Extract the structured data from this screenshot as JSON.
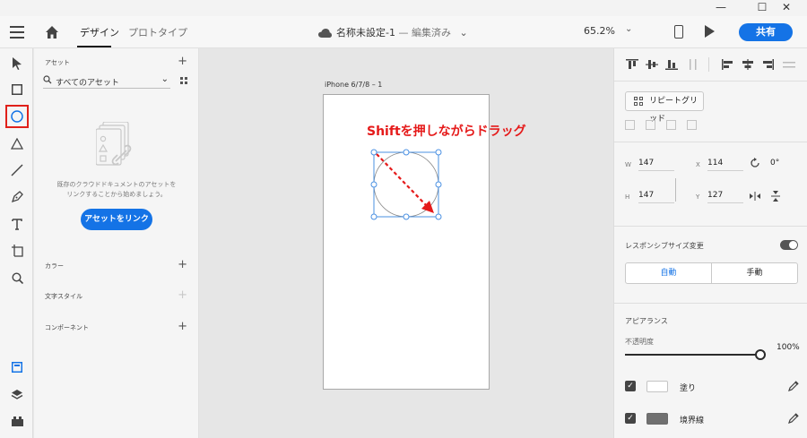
{
  "window": {
    "minimize": "—",
    "maximize": "☐",
    "close": "✕"
  },
  "header": {
    "tabs": [
      {
        "label": "デザイン"
      },
      {
        "label": "プロトタイプ"
      }
    ],
    "doc_title": "名称未設定-1",
    "doc_status": " — 編集済み",
    "zoom": "65.2%",
    "share_label": "共有"
  },
  "toolbar": {
    "tools": [
      "select",
      "rectangle",
      "ellipse",
      "polygon",
      "line",
      "pen",
      "text",
      "artboard",
      "zoom"
    ],
    "selected_tool": "ellipse",
    "bottom_tools": [
      "document-assets",
      "layers",
      "plugins"
    ]
  },
  "assets": {
    "title": "アセット",
    "filter": "すべてのアセット",
    "empty_message_line1": "既存のクラウドドキュメントのアセットを",
    "empty_message_line2": "リンクすることから始めましょう。",
    "link_button": "アセットをリンク",
    "sections": [
      {
        "label": "カラー"
      },
      {
        "label": "文字スタイル"
      },
      {
        "label": "コンポーネント"
      }
    ]
  },
  "canvas": {
    "artboard_name": "iPhone 6/7/8 – 1",
    "instruction": "Shiftを押しながらドラッグ",
    "annotation_color": "#e51a1a",
    "selection_color": "#4a90e2"
  },
  "properties": {
    "repeat_grid": "リピートグリッド",
    "transform": {
      "w_label": "W",
      "w": "147",
      "x_label": "X",
      "x": "114",
      "rotation": "0°",
      "h_label": "H",
      "h": "147",
      "y_label": "Y",
      "y": "127"
    },
    "responsive_resize": "レスポンシブサイズ変更",
    "resize_modes": [
      "自動",
      "手動"
    ],
    "appearance": "アピアランス",
    "opacity_label": "不透明度",
    "opacity": "100%",
    "fill_label": "塗り",
    "fill_color": "#ffffff",
    "border_label": "境界線",
    "border_color": "#707070"
  },
  "colors": {
    "accent": "#1473e6"
  }
}
